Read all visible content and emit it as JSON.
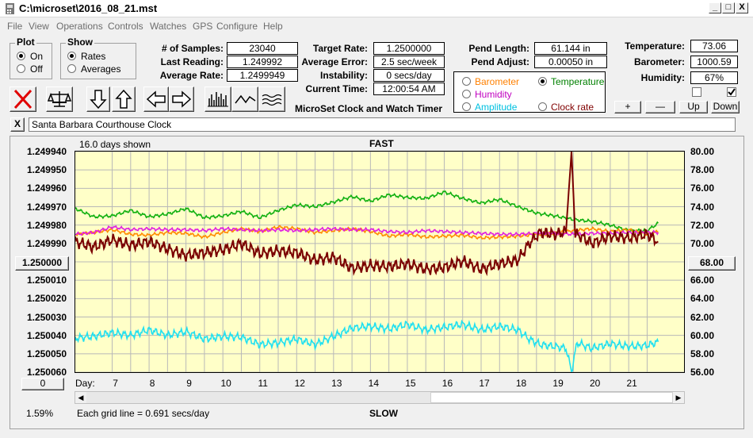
{
  "window": {
    "title": "C:\\microset\\2016_08_21.mst",
    "minimize": "_",
    "maximize": "□",
    "close": "X"
  },
  "menu": [
    "File",
    "View",
    "Operations",
    "Controls",
    "Watches",
    "GPS",
    "Configure",
    "Help"
  ],
  "plot_group": {
    "title": "Plot",
    "options": [
      "On",
      "Off"
    ],
    "selected": "On"
  },
  "show_group": {
    "title": "Show",
    "options": [
      "Rates",
      "Averages"
    ],
    "selected": "Rates"
  },
  "stats": {
    "samples_label": "# of Samples:",
    "samples_value": "23040",
    "last_reading_label": "Last Reading:",
    "last_reading_value": "1.249992",
    "average_rate_label": "Average Rate:",
    "average_rate_value": "1.2499949",
    "target_rate_label": "Target Rate:",
    "target_rate_value": "1.2500000",
    "average_error_label": "Average Error:",
    "average_error_value": "2.5 sec/week",
    "instability_label": "Instability:",
    "instability_value": "0 secs/day",
    "current_time_label": "Current Time:",
    "current_time_value": "12:00:54 AM",
    "pend_length_label": "Pend Length:",
    "pend_length_value": "61.144 in",
    "pend_adjust_label": "Pend Adjust:",
    "pend_adjust_value": "0.00050 in",
    "temperature_label": "Temperature:",
    "temperature_value": "73.06",
    "barometer_label": "Barometer:",
    "barometer_value": "1000.59",
    "humidity_label": "Humidity:",
    "humidity_value": "67%"
  },
  "app_caption": "MicroSet Clock and Watch Timer",
  "sensor_select": {
    "options": [
      {
        "label": "Barometer",
        "color": "#ff8000",
        "selected": false
      },
      {
        "label": "Temperature",
        "color": "#008000",
        "selected": true
      },
      {
        "label": "Humidity",
        "color": "#c000c0",
        "selected": false
      },
      {
        "label": "Clock rate",
        "color": "#800000",
        "selected": false
      },
      {
        "label": "Amplitude",
        "color": "#00c0e0",
        "selected": false
      }
    ]
  },
  "sensor_buttons": {
    "plus": "+",
    "minus": "—",
    "up": "Up",
    "down": "Down"
  },
  "toolbar_icons": [
    "close-x-icon",
    "balance-scale-icon",
    "arrow-down-icon",
    "arrow-up-icon",
    "arrow-left-icon",
    "arrow-right-icon",
    "bar-graph-icon",
    "line-graph-icon",
    "wave-graph-icon"
  ],
  "note": {
    "clear_button": "X",
    "text": "Santa Barbara Courthouse Clock"
  },
  "chart_labels": {
    "days_shown": "16.0 days shown",
    "fast": "FAST",
    "slow": "SLOW",
    "day_label": "Day:",
    "grid_note": "Each grid line = 0.691 secs/day",
    "left_button": "1.250000",
    "right_button": "68.00",
    "bottom_button": "0",
    "percent": "1.59%"
  },
  "chart_data": {
    "type": "line",
    "y_left_ticks": [
      "1.249940",
      "1.249950",
      "1.249960",
      "1.249970",
      "1.249980",
      "1.249990",
      "1.250000",
      "1.250010",
      "1.250020",
      "1.250030",
      "1.250040",
      "1.250050",
      "1.250060"
    ],
    "y_right_ticks": [
      "80.00",
      "78.00",
      "76.00",
      "74.00",
      "72.00",
      "70.00",
      "68.00",
      "66.00",
      "64.00",
      "62.00",
      "60.00",
      "58.00",
      "56.00"
    ],
    "x_ticks": [
      "7",
      "8",
      "9",
      "10",
      "11",
      "12",
      "13",
      "14",
      "15",
      "16",
      "17",
      "18",
      "19",
      "20",
      "21"
    ],
    "xlim": [
      6.0,
      22.5
    ],
    "y_right_range": [
      56,
      80
    ],
    "grid": true,
    "series": [
      {
        "name": "Temperature",
        "color": "#10b010",
        "x": [
          6.0,
          6.5,
          7.0,
          7.5,
          8.0,
          8.5,
          9.0,
          9.5,
          10.0,
          10.5,
          11.0,
          11.5,
          12.0,
          12.5,
          13.0,
          13.5,
          14.0,
          14.5,
          15.0,
          15.5,
          16.0,
          16.5,
          17.0,
          17.5,
          18.0,
          18.5,
          19.0,
          19.5,
          20.0,
          20.5,
          21.0,
          21.5,
          21.8
        ],
        "y": [
          73.8,
          72.9,
          73.0,
          73.6,
          72.9,
          73.2,
          73.8,
          72.8,
          73.0,
          73.5,
          72.8,
          73.6,
          74.2,
          74.0,
          74.5,
          75.1,
          74.6,
          75.3,
          75.0,
          74.9,
          75.6,
          74.9,
          74.4,
          74.8,
          74.0,
          73.3,
          73.0,
          72.6,
          72.4,
          72.0,
          71.4,
          71.4,
          72.2
        ]
      },
      {
        "name": "Barometer",
        "color": "#ff8c00",
        "x": [
          6.0,
          6.5,
          7.0,
          7.5,
          8.0,
          8.5,
          9.0,
          9.5,
          10.0,
          10.5,
          11.0,
          11.5,
          12.0,
          12.5,
          13.0,
          13.5,
          14.0,
          14.5,
          15.0,
          15.5,
          16.0,
          16.5,
          17.0,
          17.5,
          18.0,
          18.5,
          19.0,
          19.5,
          20.0,
          20.5,
          21.0,
          21.5,
          21.8
        ],
        "y": [
          71.0,
          71.2,
          71.5,
          71.0,
          70.9,
          71.2,
          71.1,
          70.7,
          71.2,
          71.6,
          71.3,
          71.8,
          71.6,
          71.2,
          71.4,
          71.6,
          71.3,
          70.8,
          71.0,
          70.7,
          70.8,
          70.9,
          70.6,
          70.7,
          70.8,
          71.0,
          71.1,
          71.4,
          71.6,
          71.3,
          71.5,
          71.0,
          71.3
        ]
      },
      {
        "name": "Humidity",
        "color": "#e020e0",
        "x": [
          6.0,
          6.5,
          7.0,
          7.5,
          8.0,
          8.5,
          9.0,
          9.5,
          10.0,
          10.5,
          11.0,
          11.5,
          12.0,
          12.5,
          13.0,
          13.5,
          14.0,
          14.5,
          15.0,
          15.5,
          16.0,
          16.5,
          17.0,
          17.5,
          18.0,
          18.5,
          19.0,
          19.5,
          20.0,
          20.5,
          21.0,
          21.5,
          21.8
        ],
        "y": [
          71.0,
          71.2,
          71.8,
          71.5,
          71.6,
          71.5,
          71.5,
          71.4,
          71.6,
          71.5,
          71.4,
          71.5,
          71.4,
          71.5,
          71.6,
          71.5,
          71.5,
          71.3,
          71.2,
          71.4,
          71.3,
          71.2,
          71.1,
          71.0,
          71.0,
          71.1,
          71.1,
          71.0,
          71.1,
          71.1,
          71.2,
          71.2,
          71.2
        ]
      },
      {
        "name": "Clock rate",
        "color": "#7a0000",
        "x": [
          6.0,
          6.5,
          7.0,
          7.5,
          8.0,
          8.5,
          9.0,
          9.5,
          10.0,
          10.5,
          11.0,
          11.5,
          12.0,
          12.5,
          13.0,
          13.5,
          14.0,
          14.5,
          15.0,
          15.5,
          16.0,
          16.5,
          17.0,
          17.5,
          18.0,
          18.3,
          18.6,
          19.0,
          19.3,
          19.45,
          19.55,
          19.7,
          20.0,
          20.5,
          21.0,
          21.5,
          21.8
        ],
        "y": [
          70.2,
          69.6,
          70.4,
          69.8,
          70.2,
          69.4,
          68.7,
          69.0,
          69.3,
          70.0,
          68.9,
          69.2,
          69.0,
          68.2,
          68.5,
          67.3,
          67.6,
          67.5,
          67.8,
          67.2,
          67.4,
          68.1,
          67.2,
          67.8,
          68.2,
          70.0,
          71.2,
          71.0,
          71.3,
          80.0,
          71.0,
          70.8,
          70.0,
          70.8,
          70.6,
          71.0,
          70.2
        ]
      },
      {
        "name": "Amplitude",
        "color": "#20e0f0",
        "x": [
          6.0,
          6.5,
          7.0,
          7.5,
          8.0,
          8.5,
          9.0,
          9.5,
          10.0,
          10.5,
          11.0,
          11.5,
          12.0,
          12.5,
          13.0,
          13.5,
          14.0,
          14.5,
          15.0,
          15.5,
          16.0,
          16.5,
          17.0,
          17.5,
          18.0,
          18.3,
          18.6,
          19.0,
          19.3,
          19.45,
          19.6,
          20.0,
          20.5,
          21.0,
          21.5,
          21.8
        ],
        "y": [
          59.7,
          59.9,
          60.3,
          60.0,
          60.6,
          60.0,
          60.4,
          59.6,
          59.9,
          59.8,
          59.0,
          59.2,
          59.6,
          59.0,
          59.9,
          60.8,
          61.0,
          60.7,
          61.2,
          60.6,
          60.9,
          61.2,
          60.6,
          61.0,
          60.6,
          59.6,
          59.0,
          58.8,
          58.6,
          56.1,
          59.2,
          58.6,
          59.1,
          58.8,
          58.9,
          59.3
        ]
      }
    ]
  }
}
